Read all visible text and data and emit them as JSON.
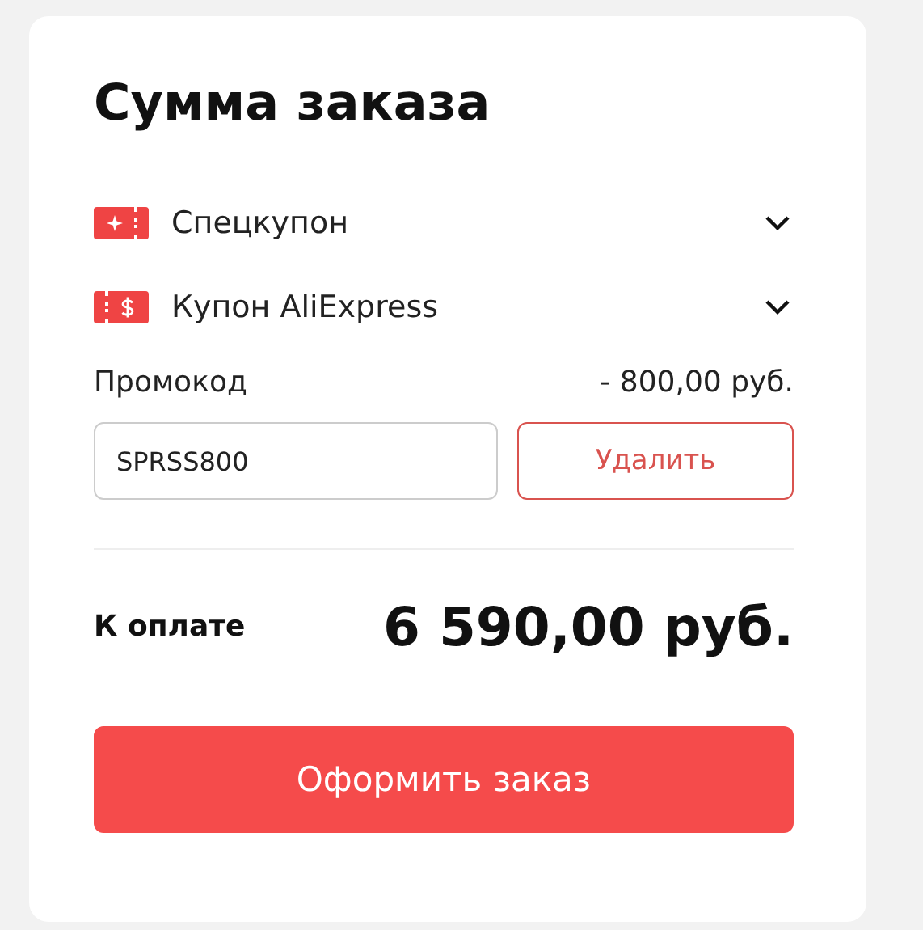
{
  "title": "Сумма заказа",
  "coupons": [
    {
      "kind": "special",
      "label": "Спецкупон",
      "expanded": false
    },
    {
      "kind": "store",
      "label": "Купон AliExpress",
      "expanded": false
    }
  ],
  "promo": {
    "label": "Промокод",
    "discount": "- 800,00 руб.",
    "value": "SPRSS800",
    "remove_button": "Удалить"
  },
  "total": {
    "label": "К оплате",
    "amount": "6 590,00 руб."
  },
  "checkout_button": "Оформить заказ"
}
